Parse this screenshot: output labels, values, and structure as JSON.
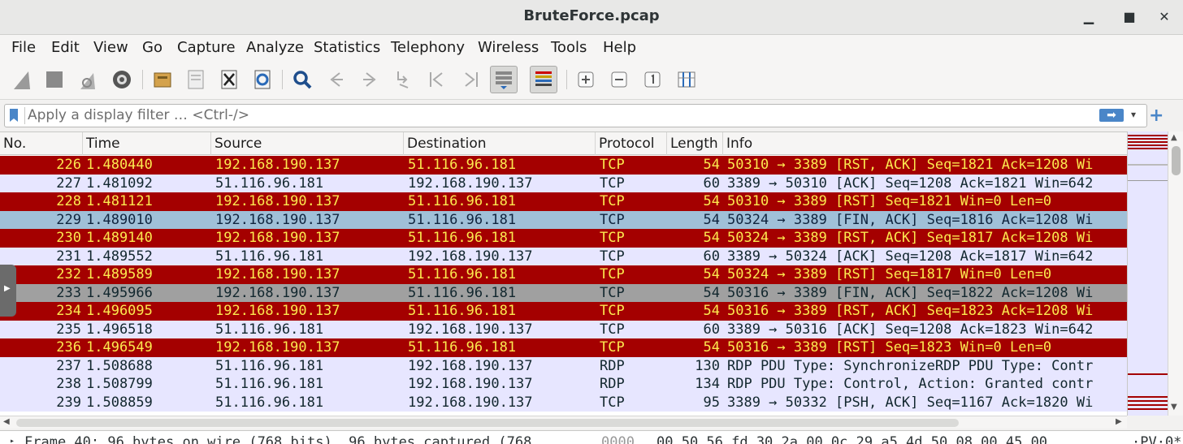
{
  "window": {
    "title": "BruteForce.pcap",
    "minimize": "▪",
    "maximize": "▫",
    "close": "✕"
  },
  "menu": [
    "File",
    "Edit",
    "View",
    "Go",
    "Capture",
    "Analyze",
    "Statistics",
    "Telephony",
    "Wireless",
    "Tools",
    "Help"
  ],
  "toolbar": {
    "icons": [
      "shark-fin-start-icon",
      "stop-icon",
      "restart-icon",
      "capture-options-icon",
      "open-file-icon",
      "save-file-icon",
      "close-file-icon",
      "reload-icon",
      "find-packet-icon",
      "go-back-icon",
      "go-forward-icon",
      "go-to-packet-icon",
      "first-packet-icon",
      "last-packet-icon",
      "autoscroll-icon",
      "colorize-icon",
      "zoom-in-icon",
      "zoom-out-icon",
      "normal-size-icon",
      "resize-columns-icon"
    ]
  },
  "filter": {
    "placeholder": "Apply a display filter … <Ctrl-/>"
  },
  "columns": [
    "No.",
    "Time",
    "Source",
    "Destination",
    "Protocol",
    "Length",
    "Info"
  ],
  "packets": [
    {
      "no": "226",
      "time": "1.480440",
      "src": "192.168.190.137",
      "dst": "51.116.96.181",
      "proto": "TCP",
      "len": "54",
      "info": "50310 → 3389 [RST, ACK] Seq=1821 Ack=1208 Wi",
      "style": "rst"
    },
    {
      "no": "227",
      "time": "1.481092",
      "src": "51.116.96.181",
      "dst": "192.168.190.137",
      "proto": "TCP",
      "len": "60",
      "info": "3389 → 50310 [ACK] Seq=1208 Ack=1821 Win=642",
      "style": "norm"
    },
    {
      "no": "228",
      "time": "1.481121",
      "src": "192.168.190.137",
      "dst": "51.116.96.181",
      "proto": "TCP",
      "len": "54",
      "info": "50310 → 3389 [RST] Seq=1821 Win=0 Len=0",
      "style": "rst"
    },
    {
      "no": "229",
      "time": "1.489010",
      "src": "192.168.190.137",
      "dst": "51.116.96.181",
      "proto": "TCP",
      "len": "54",
      "info": "50324 → 3389 [FIN, ACK] Seq=1816 Ack=1208 Wi",
      "style": "fin"
    },
    {
      "no": "230",
      "time": "1.489140",
      "src": "192.168.190.137",
      "dst": "51.116.96.181",
      "proto": "TCP",
      "len": "54",
      "info": "50324 → 3389 [RST, ACK] Seq=1817 Ack=1208 Wi",
      "style": "rst"
    },
    {
      "no": "231",
      "time": "1.489552",
      "src": "51.116.96.181",
      "dst": "192.168.190.137",
      "proto": "TCP",
      "len": "60",
      "info": "3389 → 50324 [ACK] Seq=1208 Ack=1817 Win=642",
      "style": "norm"
    },
    {
      "no": "232",
      "time": "1.489589",
      "src": "192.168.190.137",
      "dst": "51.116.96.181",
      "proto": "TCP",
      "len": "54",
      "info": "50324 → 3389 [RST] Seq=1817 Win=0 Len=0",
      "style": "rst"
    },
    {
      "no": "233",
      "time": "1.495966",
      "src": "192.168.190.137",
      "dst": "51.116.96.181",
      "proto": "TCP",
      "len": "54",
      "info": "50316 → 3389 [FIN, ACK] Seq=1822 Ack=1208 Wi",
      "style": "fin2"
    },
    {
      "no": "234",
      "time": "1.496095",
      "src": "192.168.190.137",
      "dst": "51.116.96.181",
      "proto": "TCP",
      "len": "54",
      "info": "50316 → 3389 [RST, ACK] Seq=1823 Ack=1208 Wi",
      "style": "rst"
    },
    {
      "no": "235",
      "time": "1.496518",
      "src": "51.116.96.181",
      "dst": "192.168.190.137",
      "proto": "TCP",
      "len": "60",
      "info": "3389 → 50316 [ACK] Seq=1208 Ack=1823 Win=642",
      "style": "norm"
    },
    {
      "no": "236",
      "time": "1.496549",
      "src": "192.168.190.137",
      "dst": "51.116.96.181",
      "proto": "TCP",
      "len": "54",
      "info": "50316 → 3389 [RST] Seq=1823 Win=0 Len=0",
      "style": "rst"
    },
    {
      "no": "237",
      "time": "1.508688",
      "src": "51.116.96.181",
      "dst": "192.168.190.137",
      "proto": "RDP",
      "len": "130",
      "info": "RDP PDU Type: SynchronizeRDP PDU Type: Contr",
      "style": "norm"
    },
    {
      "no": "238",
      "time": "1.508799",
      "src": "51.116.96.181",
      "dst": "192.168.190.137",
      "proto": "RDP",
      "len": "134",
      "info": "RDP PDU Type: Control, Action: Granted contr",
      "style": "norm"
    },
    {
      "no": "239",
      "time": "1.508859",
      "src": "51.116.96.181",
      "dst": "192.168.190.137",
      "proto": "TCP",
      "len": "95",
      "info": "3389 → 50332 [PSH, ACK] Seq=1167 Ack=1820 Wi",
      "style": "norm"
    }
  ],
  "details": {
    "frame": "Frame 40: 96 bytes on wire (768 bits), 96 bytes captured (768",
    "offset": "0000",
    "hex": "00 50 56 fd 30 2a 00 0c  29 a5 4d 50 08 00 45 00",
    "ascii": "·PV·0*"
  },
  "colors": {
    "rst_bg": "#a40000",
    "rst_fg": "#fce94f",
    "fin_bg": "#a0c0d8",
    "norm_bg": "#e7e6ff",
    "accent": "#4a86c8"
  }
}
